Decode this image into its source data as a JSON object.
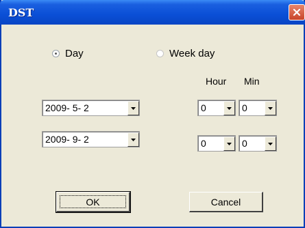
{
  "window": {
    "title": "DST"
  },
  "mode": {
    "day_label": "Day",
    "week_day_label": "Week day",
    "selected": "Day"
  },
  "columns": {
    "hour_label": "Hour",
    "min_label": "Min"
  },
  "start": {
    "date": "2009- 5- 2",
    "hour": "0",
    "min": "0"
  },
  "end": {
    "date": "2009- 9- 2",
    "hour": "0",
    "min": "0"
  },
  "buttons": {
    "ok_label": "OK",
    "cancel_label": "Cancel"
  },
  "colors": {
    "title_bar": "#0a4fd6",
    "dialog_bg": "#ece9d8",
    "close_button": "#c8452a"
  },
  "icons": {
    "close": "close-icon",
    "dropdown": "chevron-down-icon"
  }
}
